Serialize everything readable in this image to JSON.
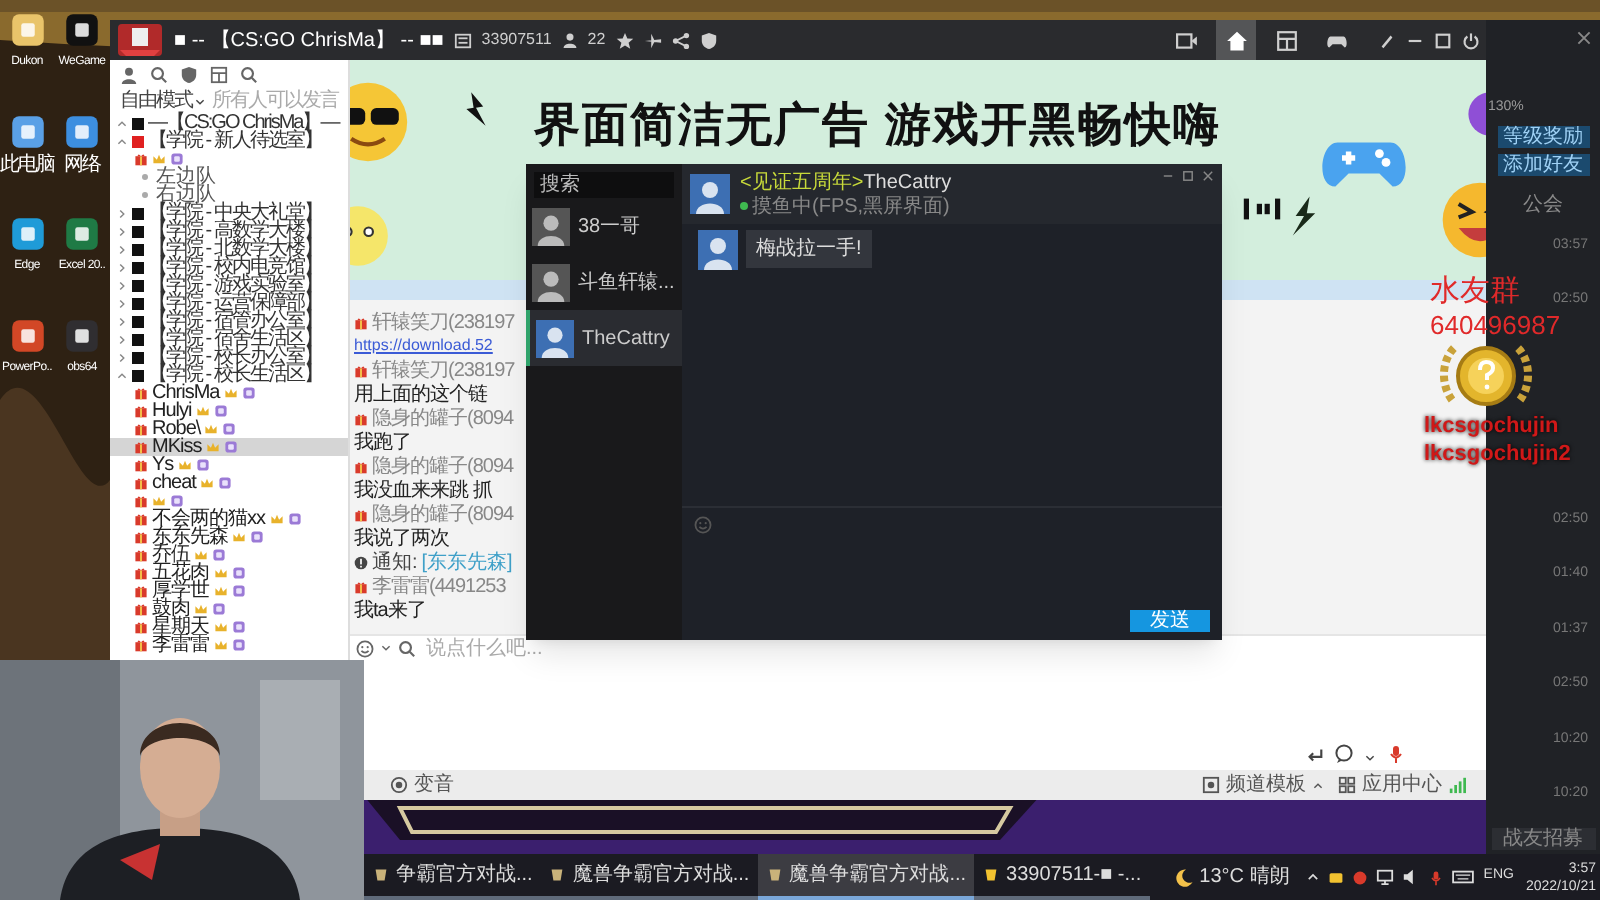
{
  "desktop_icons": [
    {
      "label": "Dukon",
      "kind": "folder"
    },
    {
      "label": "WeGame",
      "kind": "wegame"
    },
    {
      "label": "此电脑",
      "kind": "computer"
    },
    {
      "label": "网络",
      "kind": "network"
    },
    {
      "label": "Edge",
      "kind": "edge"
    },
    {
      "label": "Excel 20..",
      "kind": "excel"
    },
    {
      "label": "PowerPo..",
      "kind": "powerpoint"
    },
    {
      "label": "obs64",
      "kind": "obs"
    }
  ],
  "main_window": {
    "title": "■ -- 【CS:GO ChrisMa】 -- ■■",
    "room_id": "33907511",
    "online_count": "22",
    "nav_tabs": [
      {
        "kind": "video",
        "selected": false
      },
      {
        "kind": "home",
        "selected": true
      },
      {
        "kind": "grid",
        "selected": false
      },
      {
        "kind": "gamepad",
        "selected": false
      }
    ],
    "mode": "自由模式",
    "speak_hint": "所有人可以发言",
    "channels": [
      {
        "name": "—【CS:GO ChrisMa】—",
        "kind": "room",
        "color": "#111111",
        "expanded": true,
        "selected": false,
        "children": [
          {
            "name": "【学院 - 新人待选室】",
            "kind": "room",
            "color": "#e02020",
            "expanded": true,
            "selected": false,
            "children": [
              {
                "kind": "user",
                "selected": false
              },
              {
                "name": "左边队",
                "kind": "team",
                "selected": false
              },
              {
                "name": "右边队",
                "kind": "team",
                "selected": false
              }
            ]
          },
          {
            "name": "【学院 - 中央大礼堂】",
            "kind": "room",
            "color": "#111111",
            "expanded": false,
            "selected": false
          },
          {
            "name": "【学院 - 高数学大楼】",
            "kind": "room",
            "color": "#111111",
            "expanded": false,
            "selected": false
          },
          {
            "name": "【学院 - 北数学大楼】",
            "kind": "room",
            "color": "#111111",
            "expanded": false,
            "selected": false
          },
          {
            "name": "【学院 - 校内电竞馆】",
            "kind": "room",
            "color": "#111111",
            "expanded": false,
            "selected": false
          },
          {
            "name": "【学院 - 游戏实验室】",
            "kind": "room",
            "color": "#111111",
            "expanded": false,
            "selected": false
          },
          {
            "name": "【学院 - 运营保障部】",
            "kind": "room",
            "color": "#111111",
            "expanded": false,
            "selected": false
          },
          {
            "name": "【学院 - 宿管办公室】",
            "kind": "room",
            "color": "#111111",
            "expanded": false,
            "selected": false
          },
          {
            "name": "【学院 - 宿舍生活区】",
            "kind": "room",
            "color": "#111111",
            "expanded": false,
            "selected": false
          },
          {
            "name": "【学院 - 校长办公室】",
            "kind": "room",
            "color": "#111111",
            "expanded": false,
            "selected": false
          },
          {
            "name": "【学院 - 校长生活区】",
            "kind": "room",
            "color": "#111111",
            "expanded": true,
            "selected": false,
            "children": [
              {
                "name": "ChrisMa",
                "kind": "user",
                "selected": false
              },
              {
                "name": "Hulyi",
                "kind": "user",
                "selected": false
              },
              {
                "name": "Robe\\",
                "kind": "user",
                "selected": false
              },
              {
                "name": "MKiss",
                "kind": "user",
                "selected": true
              },
              {
                "name": "Ys",
                "kind": "user",
                "selected": false
              },
              {
                "name": "cheat",
                "kind": "user",
                "selected": false
              },
              {
                "kind": "user",
                "selected": false
              },
              {
                "name": "不会两的猫xx",
                "kind": "user",
                "selected": false
              },
              {
                "name": "东东先森",
                "kind": "user",
                "selected": false
              },
              {
                "name": "乔伍",
                "kind": "user",
                "selected": false
              },
              {
                "name": "五花肉",
                "kind": "user",
                "selected": false
              },
              {
                "name": "厚学世",
                "kind": "user",
                "selected": false
              },
              {
                "name": "鼓肉",
                "kind": "user",
                "selected": false
              },
              {
                "name": "星期天",
                "kind": "user",
                "selected": false
              },
              {
                "name": "李雷雷",
                "kind": "user",
                "selected": false
              }
            ]
          }
        ]
      }
    ],
    "banner": {
      "headline": "界面简洁无广告 游戏开黑畅快嗨"
    },
    "chat_messages": [
      {
        "kind": "sender",
        "text": "轩辕笑刀(238197"
      },
      {
        "kind": "link",
        "text": "https://download.52"
      },
      {
        "kind": "sender",
        "text": "轩辕笑刀(238197"
      },
      {
        "kind": "text",
        "text": "用上面的这个链"
      },
      {
        "kind": "sender",
        "text": "隐身的罐子(8094"
      },
      {
        "kind": "text",
        "text": "我跑了"
      },
      {
        "kind": "sender",
        "text": "隐身的罐子(8094"
      },
      {
        "kind": "text",
        "text": "我没血来来跳 抓"
      },
      {
        "kind": "sender",
        "text": "隐身的罐子(8094"
      },
      {
        "kind": "text",
        "text": "我说了两次"
      },
      {
        "kind": "notice",
        "label": "通知:",
        "text": "[东东先森]"
      },
      {
        "kind": "sender",
        "text": "李雷雷(4491253"
      },
      {
        "kind": "text",
        "text": "我ta来了"
      }
    ],
    "input_placeholder": "说点什么吧...",
    "bottom_bar": {
      "voice_changer": "变音",
      "template": "频道模板",
      "app_center": "应用中心"
    }
  },
  "side_panel": {
    "zoom": "130%",
    "buttons": [
      "等级奖励",
      "添加好友"
    ],
    "tab": "公会",
    "times": [
      "03:57",
      "02:50",
      "02:50",
      "01:40",
      "01:37",
      "02:50",
      "10:20",
      "10:20"
    ],
    "recruit_button": "战友招募"
  },
  "chat_popup": {
    "search_placeholder": "搜索",
    "contacts": [
      {
        "name": "38一哥",
        "selected": false
      },
      {
        "name": "斗鱼轩辕...",
        "selected": false
      },
      {
        "name": "TheCattry",
        "selected": true
      }
    ],
    "peer": {
      "tag": "<见证五周年>",
      "name": "TheCattry",
      "status": "摸鱼中(FPS,黑屏界面)",
      "online": true
    },
    "messages": [
      {
        "text": "梅战拉一手!"
      }
    ],
    "send_button": "发送"
  },
  "overlay": {
    "group_label": "水友群",
    "group_number": "640496987",
    "ids": [
      "lkcsgochujin",
      "lkcsgochujin2"
    ]
  },
  "taskbar": {
    "items": [
      {
        "label": "争霸官方对战...",
        "selected": false
      },
      {
        "label": "魔兽争霸官方对战...",
        "selected": false
      },
      {
        "label": "魔兽争霸官方对战...",
        "selected": true
      },
      {
        "label": "33907511-■ -...",
        "selected": false
      }
    ],
    "weather": "13°C 晴朗",
    "language": "ENG",
    "time": "3:57",
    "date": "2022/10/21"
  }
}
